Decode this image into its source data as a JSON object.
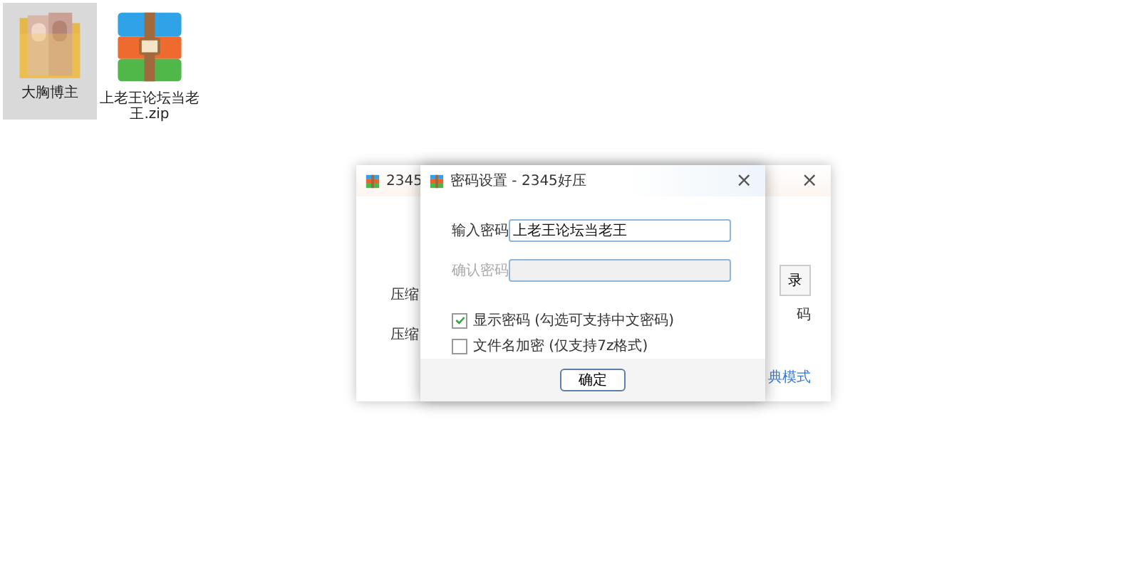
{
  "desktop": {
    "items": [
      {
        "label": "大胸博主",
        "kind": "folder",
        "selected": true
      },
      {
        "label": "上老王论坛当老王.zip",
        "kind": "archive",
        "selected": false
      }
    ]
  },
  "back_window": {
    "title": "2345",
    "close": "×",
    "labels": [
      "压缩",
      "压缩"
    ],
    "button": "录",
    "note": "码",
    "link": "典模式"
  },
  "dialog": {
    "title": "密码设置 - 2345好压",
    "close": "×",
    "fields": [
      {
        "label": "输入密码",
        "value": "上老王论坛当老王",
        "disabled": false
      },
      {
        "label": "确认密码",
        "disabled": true
      }
    ],
    "options": [
      {
        "label": "显示密码 (勾选可支持中文密码)",
        "checked": true
      },
      {
        "label": "文件名加密 (仅支持7z格式)",
        "checked": false
      }
    ],
    "button": "确定"
  }
}
